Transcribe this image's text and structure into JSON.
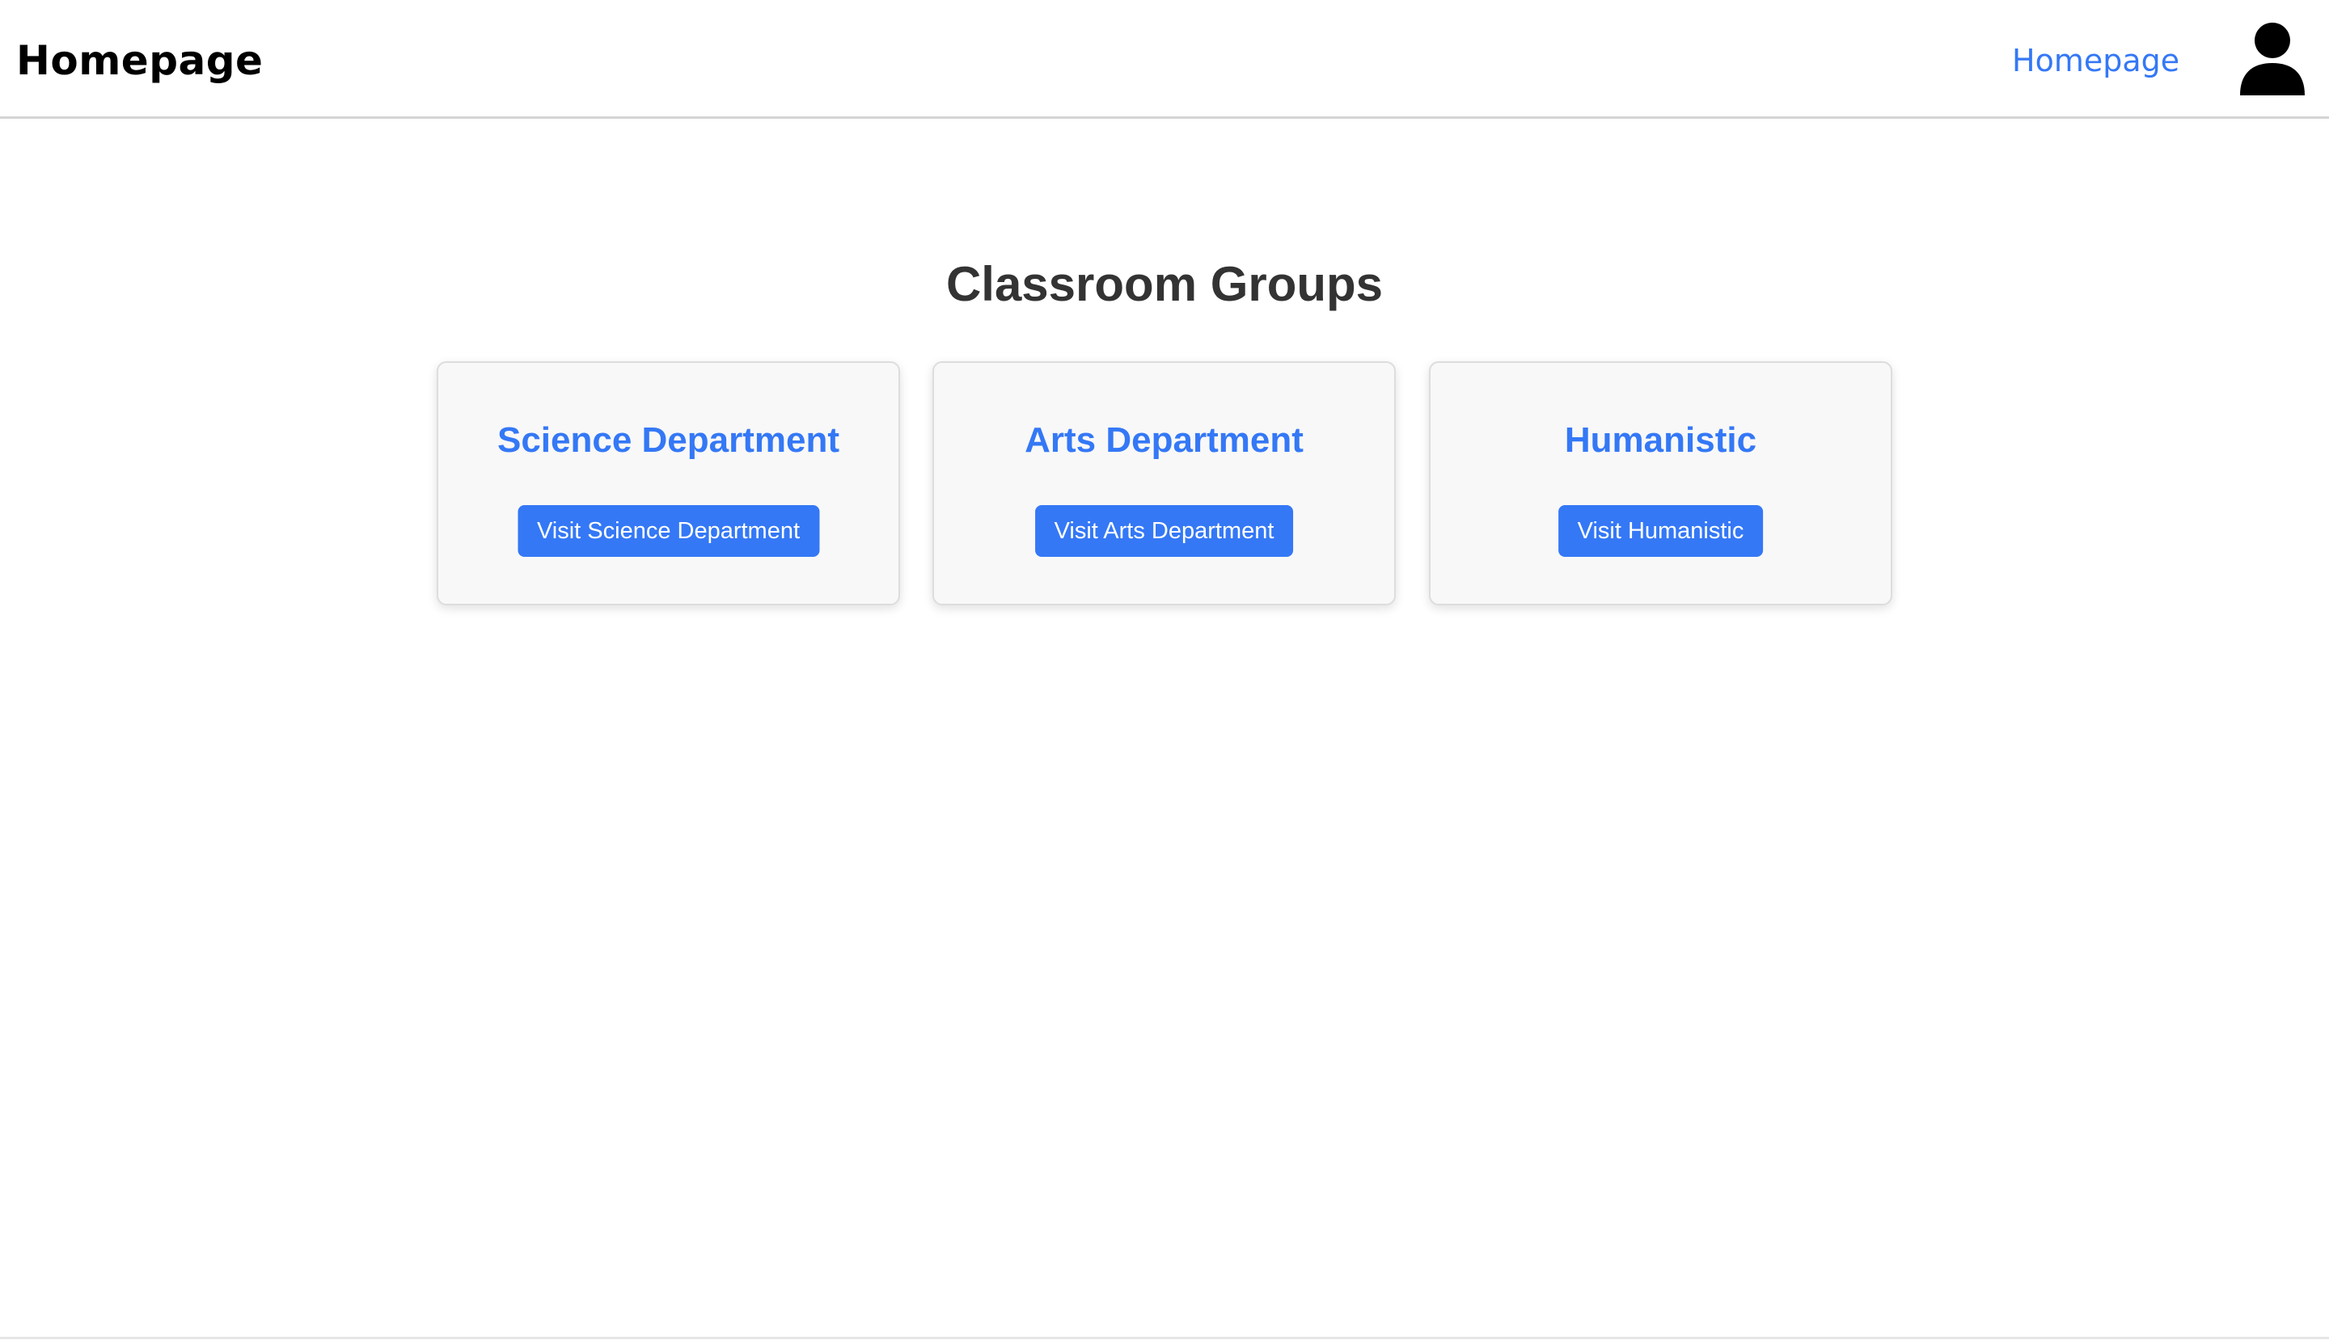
{
  "header": {
    "brand": "Homepage",
    "nav_link": "Homepage",
    "avatar_icon": "user-icon"
  },
  "main": {
    "title": "Classroom Groups",
    "cards": [
      {
        "title": "Science Department",
        "button": "Visit Science Department"
      },
      {
        "title": "Arts Department",
        "button": "Visit Arts Department"
      },
      {
        "title": "Humanistic",
        "button": "Visit Humanistic"
      }
    ]
  },
  "colors": {
    "accent": "#3478f6",
    "card_bg": "#f8f8f8",
    "title_text": "#333333"
  }
}
